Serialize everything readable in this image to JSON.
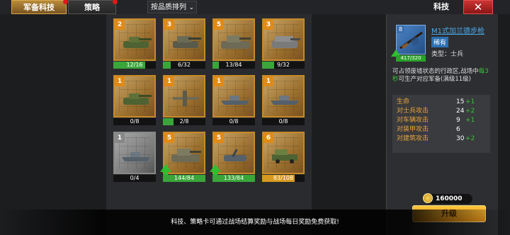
{
  "tabs": [
    {
      "label": "军备科技",
      "active": true,
      "badge": true
    },
    {
      "label": "策略",
      "active": false,
      "badge": true
    }
  ],
  "sort": {
    "label": "按品质排列",
    "chev": "⌄"
  },
  "panel_title": "科技",
  "close_label": "✕",
  "colors": {
    "accent": "#e08a18",
    "progress": "#3aa63a",
    "bonus": "#39c239",
    "button": "#f4a928",
    "close": "#c33333"
  },
  "cards": [
    {
      "level": "2",
      "count": "12/16",
      "progress": 0.75,
      "unit": "tank"
    },
    {
      "level": "3",
      "count": "6/32",
      "progress": 0.19,
      "unit": "spg"
    },
    {
      "level": "5",
      "count": "13/84",
      "progress": 0.15,
      "unit": "heavy-tank"
    },
    {
      "level": "3",
      "count": "9/32",
      "progress": 0.28,
      "unit": "td"
    },
    {
      "level": "1",
      "count": "0/8",
      "progress": 0,
      "unit": "tank"
    },
    {
      "level": "1",
      "count": "2/8",
      "progress": 0.25,
      "unit": "plane"
    },
    {
      "level": "1",
      "count": "0/8",
      "progress": 0,
      "unit": "ship"
    },
    {
      "level": "1",
      "count": "0/8",
      "progress": 0,
      "unit": "ship"
    },
    {
      "level": "1",
      "count": "0/4",
      "progress": 0,
      "unit": "ship",
      "grey": true
    },
    {
      "level": "5",
      "count": "144/84",
      "progress": 1,
      "unit": "heavy-tank",
      "arrow": true
    },
    {
      "level": "5",
      "count": "133/84",
      "progress": 1,
      "unit": "artillery",
      "arrow": true
    },
    {
      "level": "6",
      "count": "83/108",
      "progress": 0.77,
      "unit": "truck",
      "gold": true
    }
  ],
  "detail": {
    "level": "8",
    "count": "417/320",
    "name": "M1式加兰德步枪",
    "rarity": "稀有",
    "type": "类型：士兵",
    "desc_a": "可占领废墟状态的行政区,战场中",
    "desc_hl": "每3秒",
    "desc_b": "可生产对应军备(满级11级)",
    "stats": [
      {
        "label": "生命",
        "value": "15",
        "bonus": "+1"
      },
      {
        "label": "对士兵攻击",
        "value": "24",
        "bonus": "+2"
      },
      {
        "label": "对车辆攻击",
        "value": "9",
        "bonus": "+1"
      },
      {
        "label": "对装甲攻击",
        "value": "6",
        "bonus": ""
      },
      {
        "label": "对建筑攻击",
        "value": "30",
        "bonus": "+2"
      }
    ],
    "cost": "160000",
    "upgrade_label": "升级"
  },
  "banner": "科技、策略卡可通过战场结算奖励与战场每日奖励免费获取!"
}
